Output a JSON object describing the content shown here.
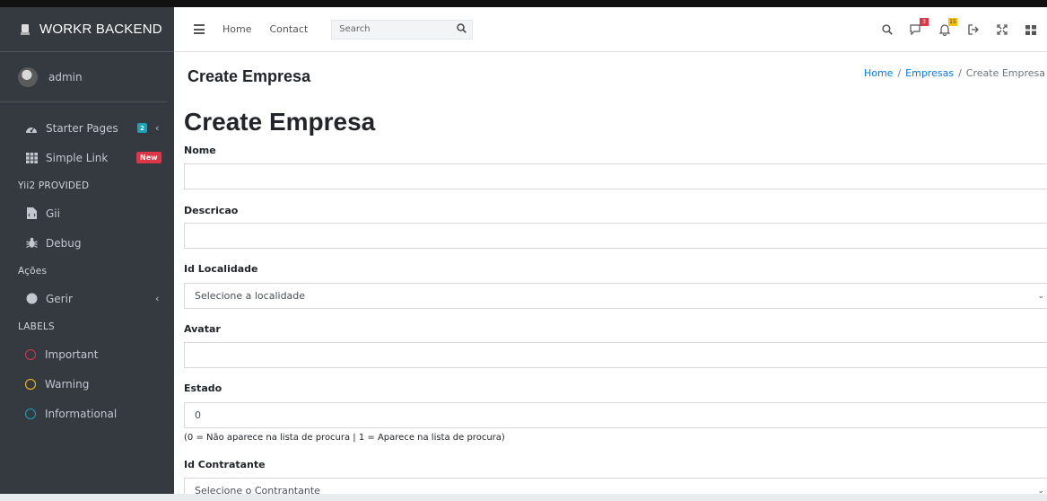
{
  "brand": {
    "title": "WORKR BACKEND"
  },
  "user": {
    "name": "admin"
  },
  "sidebar": {
    "items": [
      {
        "label": "Starter Pages",
        "icon": "dashboard-icon",
        "badge": "2"
      },
      {
        "label": "Simple Link",
        "icon": "grid-icon",
        "badge": "New"
      }
    ],
    "header_yii": "Yii2 PROVIDED",
    "yii_items": [
      {
        "label": "Gii",
        "icon": "file-code-icon"
      },
      {
        "label": "Debug",
        "icon": "bug-icon"
      }
    ],
    "header_acoes": "Ações",
    "acoes_items": [
      {
        "label": "Gerir",
        "icon": "circle-icon"
      }
    ],
    "header_labels": "LABELS",
    "labels": [
      {
        "label": "Important",
        "color": "#dc3545"
      },
      {
        "label": "Warning",
        "color": "#ffc107"
      },
      {
        "label": "Informational",
        "color": "#17a2b8"
      }
    ]
  },
  "topbar": {
    "home": "Home",
    "contact": "Contact",
    "search_placeholder": "Search",
    "messages_badge": "3",
    "notifications_badge": "15"
  },
  "page": {
    "title": "Create Empresa",
    "breadcrumb": {
      "home": "Home",
      "empresas": "Empresas",
      "current": "Create Empresa"
    },
    "heading": "Create Empresa"
  },
  "form": {
    "nome": {
      "label": "Nome",
      "value": ""
    },
    "descricao": {
      "label": "Descricao",
      "value": ""
    },
    "localidade": {
      "label": "Id Localidade",
      "value": "Selecione a localidade"
    },
    "avatar": {
      "label": "Avatar",
      "value": ""
    },
    "estado": {
      "label": "Estado",
      "value": "0",
      "help": "(0 = Não aparece na lista de procura | 1 = Aparece na lista de procura)"
    },
    "contratante": {
      "label": "Id Contratante",
      "value": "Selecione o Contrantante"
    }
  }
}
